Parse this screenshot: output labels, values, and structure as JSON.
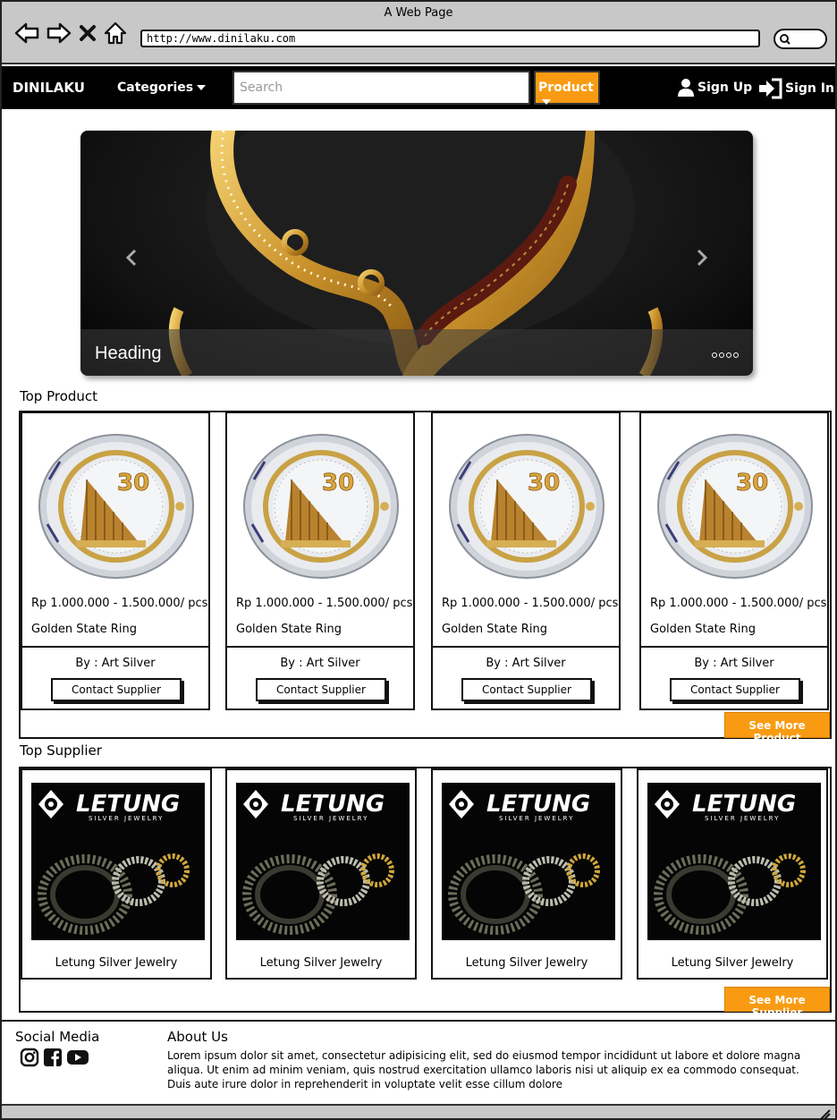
{
  "browser": {
    "window_title": "A Web Page",
    "url": "http://www.dinilaku.com"
  },
  "navbar": {
    "brand": "DINILAKU",
    "categories_label": "Categories",
    "search_placeholder": "Search",
    "product_label": "Product",
    "signup_label": "Sign Up",
    "signin_label": "Sign In"
  },
  "carousel": {
    "heading": "Heading",
    "slide_count": 4
  },
  "top_product": {
    "title": "Top Product",
    "see_more_label": "See More Product",
    "items": [
      {
        "price": "Rp 1.000.000 - 1.500.000/ pcs",
        "name": "Golden State Ring",
        "supplier": "By : Art Silver",
        "contact_label": "Contact Supplier"
      },
      {
        "price": "Rp 1.000.000 - 1.500.000/ pcs",
        "name": "Golden State Ring",
        "supplier": "By : Art Silver",
        "contact_label": "Contact Supplier"
      },
      {
        "price": "Rp 1.000.000 - 1.500.000/ pcs",
        "name": "Golden State Ring",
        "supplier": "By : Art Silver",
        "contact_label": "Contact Supplier"
      },
      {
        "price": "Rp 1.000.000 - 1.500.000/ pcs",
        "name": "Golden State Ring",
        "supplier": "By : Art Silver",
        "contact_label": "Contact Supplier"
      }
    ]
  },
  "top_supplier": {
    "title": "Top Supplier",
    "see_more_label": "See More Supplier",
    "logo_text": "LETUNG",
    "logo_subtext": "SILVER JEWELRY",
    "items": [
      {
        "name": "Letung Silver Jewelry"
      },
      {
        "name": "Letung Silver Jewelry"
      },
      {
        "name": "Letung Silver Jewelry"
      },
      {
        "name": "Letung Silver Jewelry"
      }
    ]
  },
  "footer": {
    "social_title": "Social Media",
    "social_icons": [
      "instagram-icon",
      "facebook-icon",
      "youtube-icon"
    ],
    "about_title": "About Us",
    "about_text": "Lorem ipsum dolor sit amet, consectetur adipisicing elit, sed do eiusmod tempor incididunt ut labore et dolore magna aliqua. Ut enim ad minim veniam, quis nostrud exercitation ullamco laboris nisi ut aliquip ex ea commodo consequat. Duis aute irure dolor in reprehenderit in voluptate velit esse cillum dolore"
  },
  "colors": {
    "accent": "#f99b12",
    "navbar_bg": "#000000",
    "chrome_bg": "#c8c8c8"
  }
}
